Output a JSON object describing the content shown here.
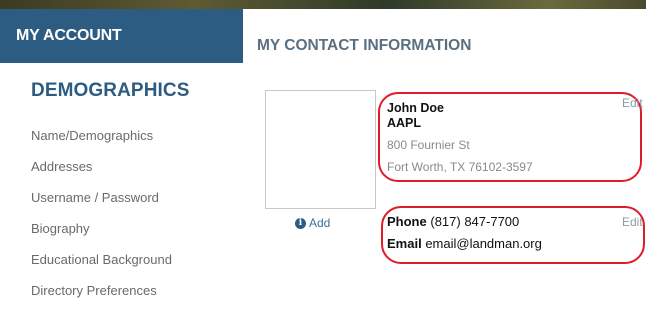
{
  "sidebar": {
    "header": "MY ACCOUNT",
    "section_title": "DEMOGRAPHICS",
    "items": [
      {
        "label": "Name/Demographics"
      },
      {
        "label": "Addresses"
      },
      {
        "label": "Username / Password"
      },
      {
        "label": "Biography"
      },
      {
        "label": "Educational Background"
      },
      {
        "label": "Directory Preferences"
      }
    ]
  },
  "main": {
    "title": "MY CONTACT INFORMATION",
    "photo": {
      "add_label": "Add",
      "icon": "info-icon"
    },
    "address_card": {
      "name": "John Doe",
      "designation": "AAPL",
      "street": "800 Fournier St",
      "city_state_zip": "Fort Worth, TX 76102-3597",
      "edit_label": "Edit"
    },
    "contact_card": {
      "phone_label": "Phone",
      "phone_value": "(817) 847-7700",
      "email_label": "Email",
      "email_value": "email@landman.org",
      "edit_label": "Edit"
    }
  },
  "colors": {
    "sidebar_header_bg": "#2d5c82",
    "section_title": "#2d5c82",
    "highlight_oval": "#e01b2a",
    "muted_text": "#8a8a8a"
  }
}
